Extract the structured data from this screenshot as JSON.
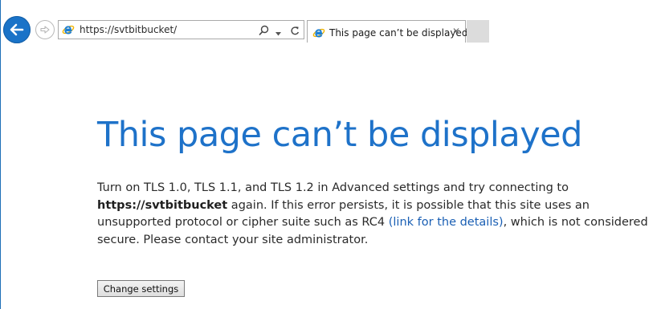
{
  "browser": {
    "url": "https://svtbitbucket/",
    "tab_title": "This page can’t be displayed",
    "tab_close": "✕"
  },
  "page": {
    "title": "This page can’t be displayed",
    "body": {
      "text1": "Turn on TLS 1.0, TLS 1.1, and TLS 1.2 in Advanced settings and try connecting to ",
      "site": "https://svtbitbucket",
      "text2": " again. If this error persists, it is possible that this site uses an unsupported protocol or cipher suite such as RC4 ",
      "link": "(link for the details)",
      "text3": ", which is not considered secure. Please contact your site administrator."
    },
    "button_label": "Change settings"
  },
  "icons": {
    "back": "back-arrow-icon",
    "forward": "forward-arrow-icon",
    "page": "internet-explorer-icon",
    "search": "search-icon",
    "dropdown": "chevron-down-icon",
    "refresh": "refresh-icon",
    "close": "close-icon"
  },
  "colors": {
    "accent": "#1e72c9",
    "link": "#1a5fb4",
    "back_button": "#1a73c8"
  }
}
